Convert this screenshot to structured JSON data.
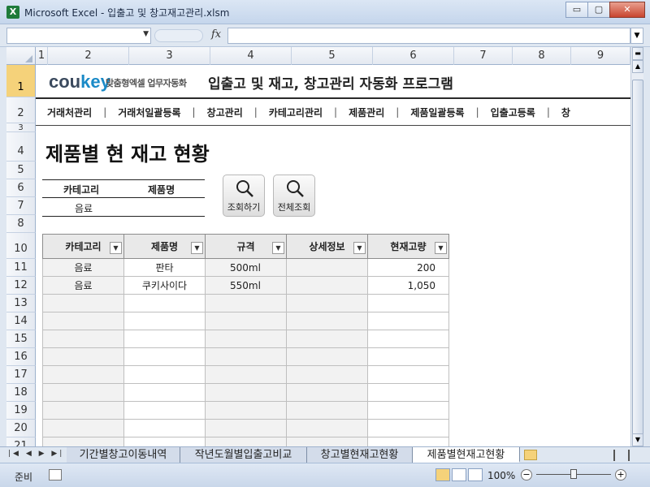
{
  "window": {
    "title": "Microsoft Excel - 입출고 및 창고재고관리.xlsm",
    "app_icon": "X",
    "min_label": "▭",
    "restore_label": "▢",
    "close_label": "✕"
  },
  "formula_bar": {
    "name_box": "",
    "fx_label": "fx",
    "formula": ""
  },
  "columns": [
    "1",
    "2",
    "3",
    "4",
    "5",
    "6",
    "7",
    "8",
    "9"
  ],
  "rows": [
    "1",
    "2",
    "3",
    "4",
    "5",
    "6",
    "7",
    "8",
    "10",
    "11",
    "12",
    "13",
    "14",
    "15",
    "16",
    "17",
    "18",
    "19",
    "20",
    "21"
  ],
  "brand": {
    "logo_a": "cou",
    "logo_b": "key",
    "tagline": "맞춤형엑셀 업무자동화"
  },
  "app_title": "입출고 및 재고, 창고관리 자동화 프로그램",
  "nav": [
    "거래처관리",
    "거래처일괄등록",
    "창고관리",
    "카테고리관리",
    "제품관리",
    "제품일괄등록",
    "입출고등록",
    "창"
  ],
  "page_title": "제품별 현 재고 현황",
  "filter": {
    "category_label": "카테고리",
    "product_label": "제품명",
    "category_value": "음료",
    "product_value": ""
  },
  "buttons": {
    "search": "조회하기",
    "search_all": "전체조회"
  },
  "table": {
    "headers": [
      "카테고리",
      "제품명",
      "규격",
      "상세정보",
      "현재고량"
    ],
    "rows": [
      [
        "음료",
        "판타",
        "500ml",
        "",
        "200"
      ],
      [
        "음료",
        "쿠키사이다",
        "550ml",
        "",
        "1,050"
      ]
    ]
  },
  "sheet_tabs": [
    "기간별창고이동내역",
    "작년도월별입출고비교",
    "창고별현재고현황",
    "제품별현재고현황"
  ],
  "status": {
    "ready": "준비",
    "zoom": "100%"
  }
}
